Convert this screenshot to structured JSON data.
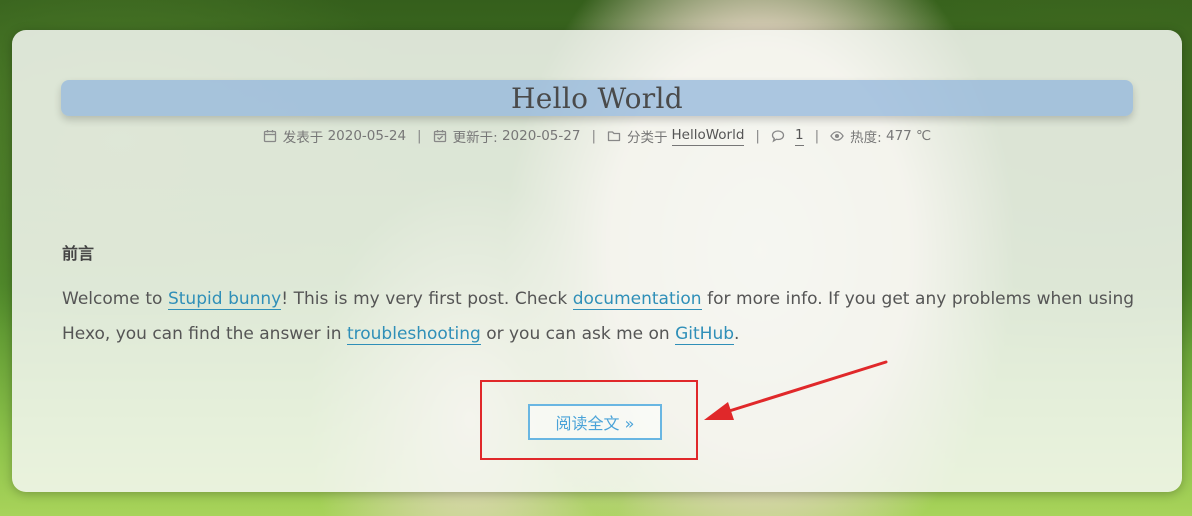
{
  "post": {
    "title": "Hello World",
    "meta": {
      "posted_label": "发表于",
      "posted_date": "2020-05-24",
      "updated_label": "更新于:",
      "updated_date": "2020-05-27",
      "category_label": "分类于",
      "category": "HelloWorld",
      "comments_count": "1",
      "views_label": "热度:",
      "views_value": "477 ℃",
      "separator": "|"
    },
    "heading": "前言",
    "paragraph": {
      "t1": "Welcome to ",
      "link1": "Stupid bunny",
      "t2": "! This is my very first post. Check ",
      "link2": "documentation",
      "t3": " for more info. If you get any problems when using Hexo, you can find the answer in ",
      "link3": "troubleshooting",
      "t4": " or you can ask me on ",
      "link4": "GitHub",
      "t5": "."
    },
    "read_more": "阅读全文 »"
  },
  "colors": {
    "title_bar": "#96b9dc",
    "link": "#2f8fb8",
    "button_border": "#69b6e2",
    "annotation_red": "#e0282a"
  },
  "icons": {
    "posted": "calendar-icon",
    "updated": "calendar-check-icon",
    "category": "folder-icon",
    "comments": "comment-icon",
    "views": "eye-icon"
  }
}
